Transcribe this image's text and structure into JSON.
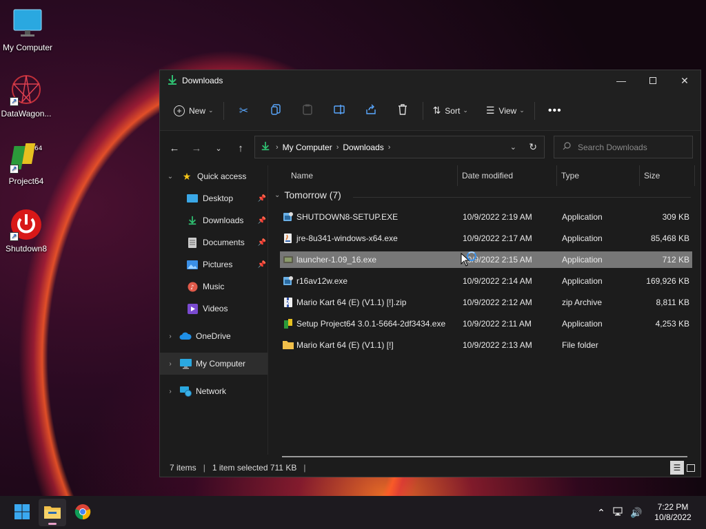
{
  "desktop": {
    "icons": [
      {
        "label": "My Computer"
      },
      {
        "label": "DataWagon..."
      },
      {
        "label": "Project64"
      },
      {
        "label": "Shutdown8"
      }
    ]
  },
  "window": {
    "title": "Downloads",
    "toolbar": {
      "new_label": "New",
      "sort_label": "Sort",
      "view_label": "View"
    },
    "address": {
      "crumbs": [
        "My Computer",
        "Downloads"
      ]
    },
    "search": {
      "placeholder": "Search Downloads"
    },
    "sidebar": {
      "quick_access": "Quick access",
      "items": [
        {
          "label": "Desktop"
        },
        {
          "label": "Downloads"
        },
        {
          "label": "Documents"
        },
        {
          "label": "Pictures"
        },
        {
          "label": "Music"
        },
        {
          "label": "Videos"
        }
      ],
      "onedrive": "OneDrive",
      "my_computer": "My Computer",
      "network": "Network"
    },
    "columns": {
      "name": "Name",
      "date": "Date modified",
      "type": "Type",
      "size": "Size"
    },
    "group": "Tomorrow (7)",
    "files": [
      {
        "name": "SHUTDOWN8-SETUP.EXE",
        "date": "10/9/2022 2:19 AM",
        "type": "Application",
        "size": "309 KB"
      },
      {
        "name": "jre-8u341-windows-x64.exe",
        "date": "10/9/2022 2:17 AM",
        "type": "Application",
        "size": "85,468 KB"
      },
      {
        "name": "launcher-1.09_16.exe",
        "date": "10/9/2022 2:15 AM",
        "type": "Application",
        "size": "712 KB"
      },
      {
        "name": "r16av12w.exe",
        "date": "10/9/2022 2:14 AM",
        "type": "Application",
        "size": "169,926 KB"
      },
      {
        "name": "Mario Kart 64 (E) (V1.1) [!].zip",
        "date": "10/9/2022 2:12 AM",
        "type": "zip Archive",
        "size": "8,811 KB"
      },
      {
        "name": "Setup Project64 3.0.1-5664-2df3434.exe",
        "date": "10/9/2022 2:11 AM",
        "type": "Application",
        "size": "4,253 KB"
      },
      {
        "name": "Mario Kart 64 (E) (V1.1) [!]",
        "date": "10/9/2022 2:13 AM",
        "type": "File folder",
        "size": ""
      }
    ],
    "status": {
      "items": "7 items",
      "selected": "1 item selected  711 KB"
    }
  },
  "taskbar": {
    "time": "7:22 PM",
    "date": "10/8/2022"
  }
}
